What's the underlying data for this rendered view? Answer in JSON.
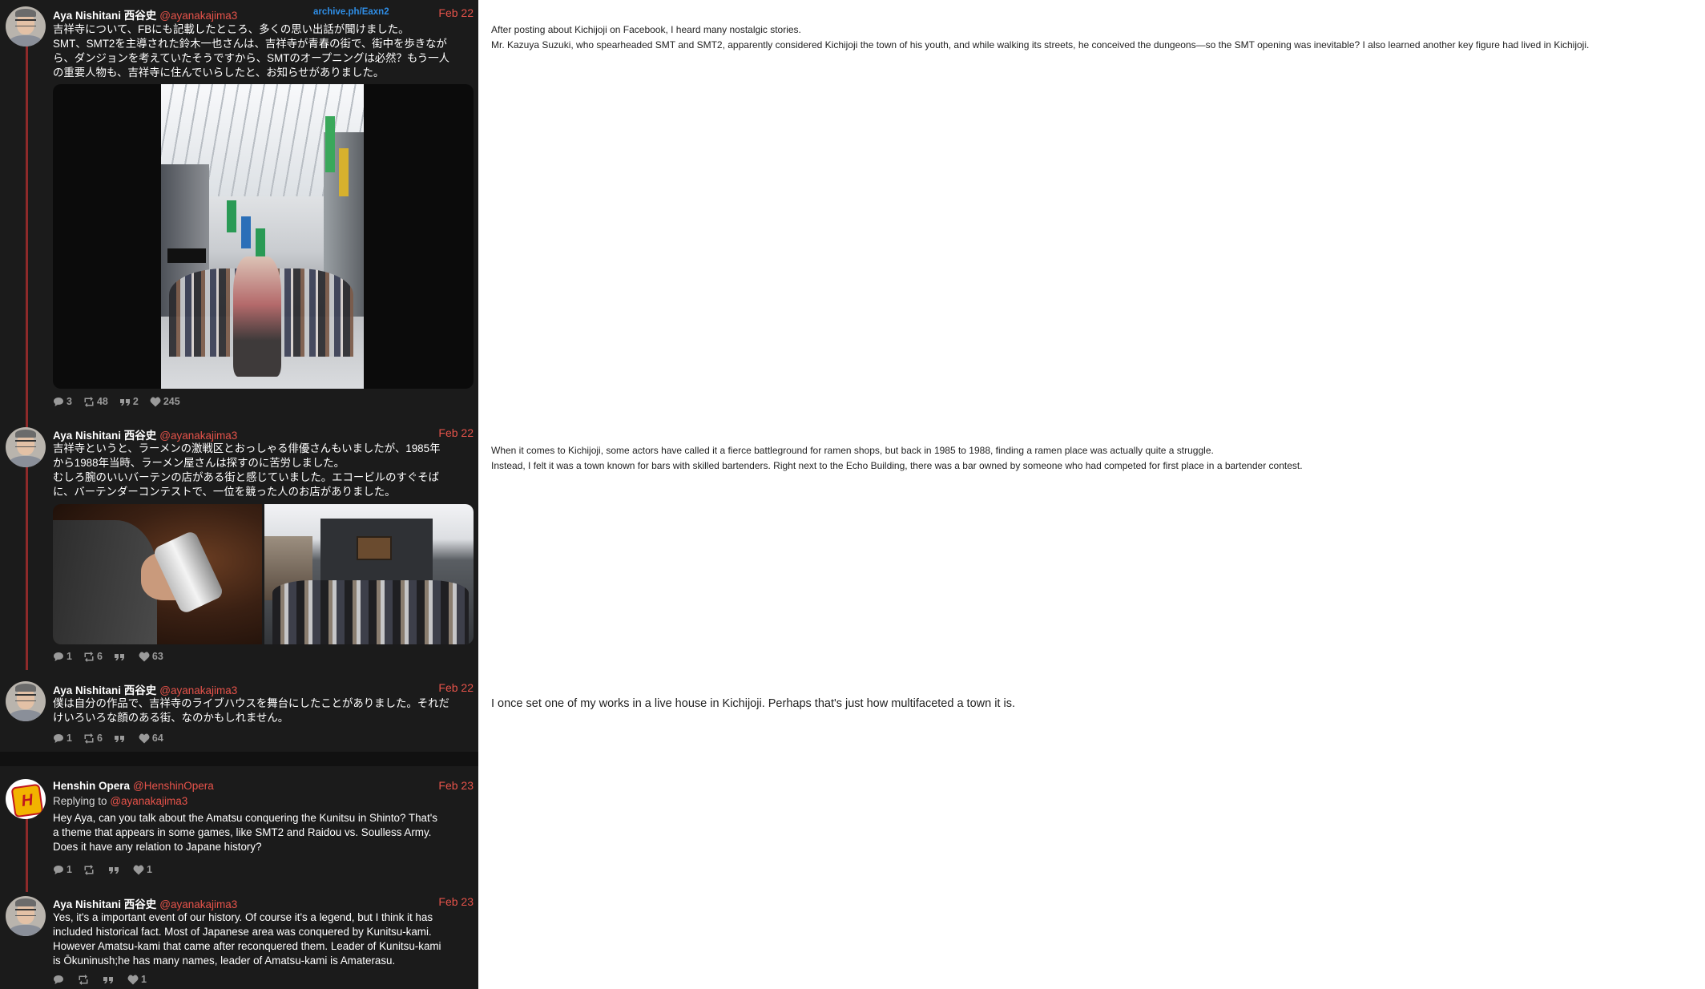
{
  "tweets": [
    {
      "author": "Aya Nishitani 西谷史",
      "handle": "@ayanakajima3",
      "date": "Feb 22",
      "archive_link": "archive.ph/Eaxn2",
      "lines": [
        "吉祥寺について、FBにも記載したところ、多くの思い出話が聞けました。",
        "SMT、SMT2を主導された鈴木一也さんは、吉祥寺が青春の街で、街中を歩きなが",
        "ら、ダンジョンを考えていたそうですから、SMTのオープニングは必然？もう一人",
        "の重要人物も、吉祥寺に住んでいらしたと、お知らせがありました。"
      ],
      "stats": {
        "replies": "3",
        "retweets": "48",
        "quotes": "2",
        "likes": "245"
      },
      "translation": [
        "After posting about Kichijoji on Facebook, I heard many nostalgic stories.",
        "Mr. Kazuya Suzuki, who spearheaded SMT and SMT2, apparently considered Kichijoji the town of his youth, and while walking its streets, he conceived the dungeons—so the SMT opening was inevitable? I also learned another key figure had lived in Kichijoji."
      ]
    },
    {
      "author": "Aya Nishitani 西谷史",
      "handle": "@ayanakajima3",
      "date": "Feb 22",
      "lines": [
        "吉祥寺というと、ラーメンの激戦区とおっしゃる俳優さんもいましたが、1985年",
        "から1988年当時、ラーメン屋さんは探すのに苦労しました。",
        "むしろ腕のいいバーテンの店がある街と感じていました。エコービルのすぐそば",
        "に、バーテンダーコンテストで、一位を競った人のお店がありました。"
      ],
      "stats": {
        "replies": "1",
        "retweets": "6",
        "quotes": "",
        "likes": "63"
      },
      "translation": [
        "When it comes to Kichijoji, some actors have called it a fierce battleground for ramen shops, but back in 1985 to 1988, finding a ramen place was actually quite a struggle.",
        "Instead, I felt it was a town known for bars with skilled bartenders. Right next to the Echo Building, there was a bar owned by someone who had competed for first place in a bartender contest."
      ]
    },
    {
      "author": "Aya Nishitani 西谷史",
      "handle": "@ayanakajima3",
      "date": "Feb 22",
      "lines": [
        "僕は自分の作品で、吉祥寺のライブハウスを舞台にしたことがありました。それだ",
        "けいろいろな顔のある街、なのかもしれません。"
      ],
      "stats": {
        "replies": "1",
        "retweets": "6",
        "quotes": "",
        "likes": "64"
      },
      "translation": [
        "I once set one of my works in a live house in Kichijoji. Perhaps that's just how multifaceted a town it is."
      ]
    },
    {
      "author": "Henshin Opera",
      "handle": "@HenshinOpera",
      "date": "Feb 23",
      "reply_prefix": "Replying to",
      "reply_handle": "@ayanakajima3",
      "lines": [
        "Hey Aya, can you talk about the Amatsu conquering the Kunitsu in Shinto? That's",
        "a theme that appears in some games, like SMT2 and Raidou vs. Soulless Army.",
        "Does it have any relation to Japane history?"
      ],
      "stats": {
        "replies": "1",
        "retweets": "",
        "quotes": "",
        "likes": "1"
      }
    },
    {
      "author": "Aya Nishitani 西谷史",
      "handle": "@ayanakajima3",
      "date": "Feb 23",
      "lines": [
        "Yes, it's a important event of our history. Of course it's a legend, but I think it has",
        "included historical fact. Most of Japanese area  was conquered by Kunitsu-kami.",
        "However Amatsu-kami that came after reconquered them. Leader of Kunitsu-kami",
        "is Ōkuninush;he has many names, leader of Amatsu-kami is Amaterasu."
      ],
      "stats": {
        "replies": "",
        "retweets": "",
        "quotes": "",
        "likes": "1"
      }
    }
  ],
  "colors": {
    "panel_bg": "#1b1b1b",
    "accent": "#e6534a",
    "link": "#2f8ee6",
    "thread_line": "#8e2a2a",
    "stat_gray": "#9a9a9a"
  },
  "icons": {
    "reply": "comment-icon",
    "retweet": "retweet-icon",
    "quote": "quote-icon",
    "like": "heart-icon"
  }
}
